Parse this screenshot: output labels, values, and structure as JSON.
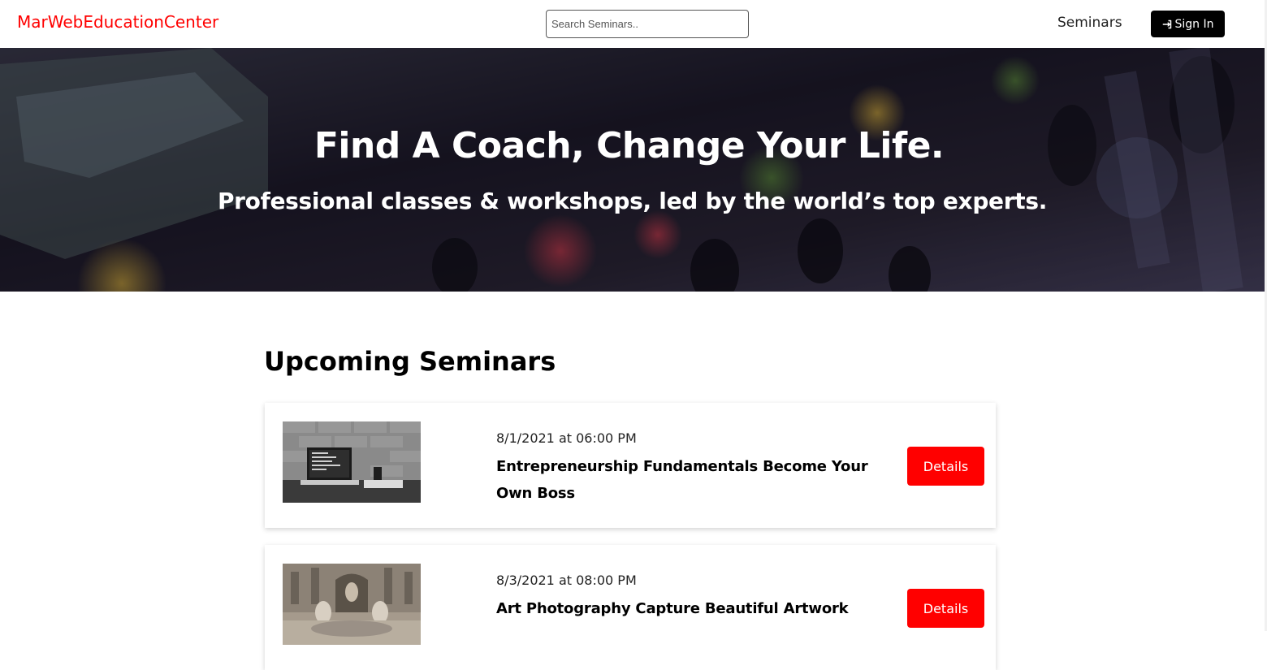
{
  "navbar": {
    "brand": "MarWebEducationCenter",
    "search_placeholder": "Search Seminars..",
    "seminars_link": "Seminars",
    "signin_label": "Sign In"
  },
  "hero": {
    "title": "Find A Coach, Change Your Life.",
    "subtitle": "Professional classes & workshops, led by the world’s top experts."
  },
  "seminars": {
    "heading": "Upcoming Seminars",
    "items": [
      {
        "date": "8/1/2021 at 06:00 PM",
        "title": "Entrepreneurship Fundamentals Become Your Own Boss",
        "details_label": "Details",
        "image": "laptop-on-desk"
      },
      {
        "date": "8/3/2021 at 08:00 PM",
        "title": "Art Photography Capture Beautiful Artwork",
        "details_label": "Details",
        "image": "fountain-statue"
      }
    ]
  },
  "colors": {
    "brand": "#ff0000",
    "accent_button": "#ff0000",
    "signin_button": "#000000"
  }
}
